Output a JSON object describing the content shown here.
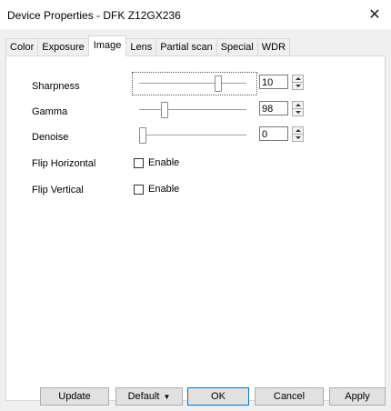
{
  "window": {
    "title": "Device Properties - DFK Z12GX236",
    "close_glyph": "✕"
  },
  "tabs": [
    {
      "label": "Color"
    },
    {
      "label": "Exposure"
    },
    {
      "label": "Image",
      "active": true
    },
    {
      "label": "Lens"
    },
    {
      "label": "Partial scan"
    },
    {
      "label": "Special"
    },
    {
      "label": "WDR"
    }
  ],
  "controls": {
    "sharpness": {
      "label": "Sharpness",
      "value": "10",
      "level": 0.75,
      "focused": true
    },
    "gamma": {
      "label": "Gamma",
      "value": "98",
      "level": 0.22
    },
    "denoise": {
      "label": "Denoise",
      "value": "0",
      "level": 0.0
    },
    "flip_horizontal": {
      "label": "Flip Horizontal",
      "checkbox_label": "Enable",
      "checked": false
    },
    "flip_vertical": {
      "label": "Flip Vertical",
      "checkbox_label": "Enable",
      "checked": false
    }
  },
  "buttons": {
    "update": "Update",
    "default": "Default",
    "default_caret": "▼",
    "ok": "OK",
    "cancel": "Cancel",
    "apply": "Apply"
  }
}
